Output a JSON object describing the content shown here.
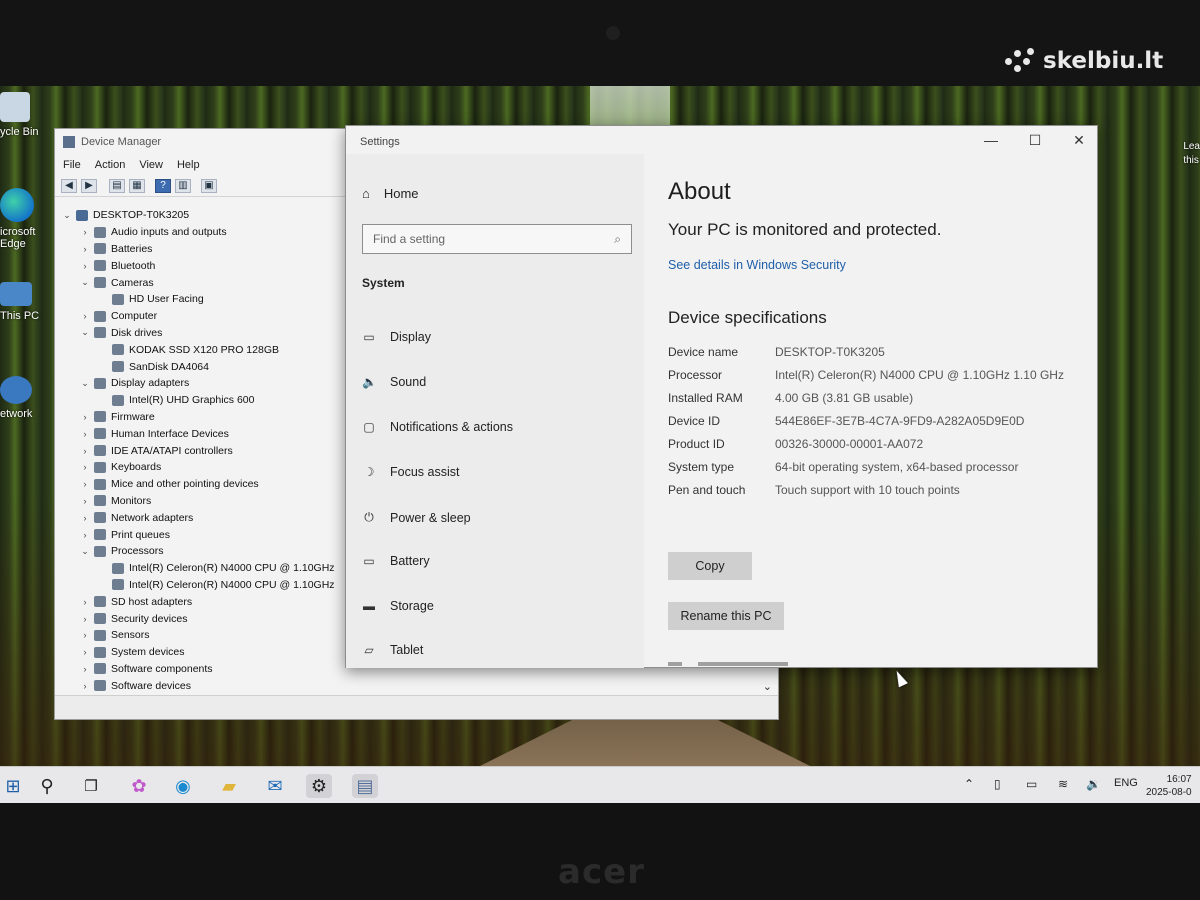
{
  "watermark": "skelbiu.lt",
  "laptop_brand": "acer",
  "desktop": {
    "icons": [
      {
        "label": "ycle Bin"
      },
      {
        "label": "icrosoft Edge"
      },
      {
        "label": "This PC"
      },
      {
        "label": "etwork"
      }
    ],
    "right_label_1": "Lea",
    "right_label_2": "this"
  },
  "device_manager": {
    "title": "Device Manager",
    "menu": [
      "File",
      "Action",
      "View",
      "Help"
    ],
    "root": "DESKTOP-T0K3205",
    "tree": [
      {
        "label": "Audio inputs and outputs",
        "level": 1,
        "expander": "collapsed",
        "icon": "audio-icon"
      },
      {
        "label": "Batteries",
        "level": 1,
        "expander": "collapsed",
        "icon": "battery-icon"
      },
      {
        "label": "Bluetooth",
        "level": 1,
        "expander": "collapsed",
        "icon": "bluetooth-icon"
      },
      {
        "label": "Cameras",
        "level": 1,
        "expander": "expanded",
        "icon": "camera-icon"
      },
      {
        "label": "HD User Facing",
        "level": 2,
        "expander": "none",
        "icon": "camera-icon"
      },
      {
        "label": "Computer",
        "level": 1,
        "expander": "collapsed",
        "icon": "computer-icon"
      },
      {
        "label": "Disk drives",
        "level": 1,
        "expander": "expanded",
        "icon": "disk-icon"
      },
      {
        "label": "KODAK SSD X120 PRO 128GB",
        "level": 2,
        "expander": "none",
        "icon": "disk-icon"
      },
      {
        "label": "SanDisk DA4064",
        "level": 2,
        "expander": "none",
        "icon": "disk-icon"
      },
      {
        "label": "Display adapters",
        "level": 1,
        "expander": "expanded",
        "icon": "monitor-icon"
      },
      {
        "label": "Intel(R) UHD Graphics 600",
        "level": 2,
        "expander": "none",
        "icon": "monitor-icon"
      },
      {
        "label": "Firmware",
        "level": 1,
        "expander": "collapsed",
        "icon": "firmware-icon"
      },
      {
        "label": "Human Interface Devices",
        "level": 1,
        "expander": "collapsed",
        "icon": "hid-icon"
      },
      {
        "label": "IDE ATA/ATAPI controllers",
        "level": 1,
        "expander": "collapsed",
        "icon": "controller-icon"
      },
      {
        "label": "Keyboards",
        "level": 1,
        "expander": "collapsed",
        "icon": "keyboard-icon"
      },
      {
        "label": "Mice and other pointing devices",
        "level": 1,
        "expander": "collapsed",
        "icon": "mouse-icon"
      },
      {
        "label": "Monitors",
        "level": 1,
        "expander": "collapsed",
        "icon": "monitor-icon"
      },
      {
        "label": "Network adapters",
        "level": 1,
        "expander": "collapsed",
        "icon": "network-icon"
      },
      {
        "label": "Print queues",
        "level": 1,
        "expander": "collapsed",
        "icon": "printer-icon"
      },
      {
        "label": "Processors",
        "level": 1,
        "expander": "expanded",
        "icon": "processor-icon"
      },
      {
        "label": "Intel(R) Celeron(R) N4000 CPU @ 1.10GHz",
        "level": 2,
        "expander": "none",
        "icon": "processor-icon"
      },
      {
        "label": "Intel(R) Celeron(R) N4000 CPU @ 1.10GHz",
        "level": 2,
        "expander": "none",
        "icon": "processor-icon"
      },
      {
        "label": "SD host adapters",
        "level": 1,
        "expander": "collapsed",
        "icon": "sd-icon"
      },
      {
        "label": "Security devices",
        "level": 1,
        "expander": "collapsed",
        "icon": "security-icon"
      },
      {
        "label": "Sensors",
        "level": 1,
        "expander": "collapsed",
        "icon": "sensor-icon"
      },
      {
        "label": "System devices",
        "level": 1,
        "expander": "collapsed",
        "icon": "system-icon"
      },
      {
        "label": "Software components",
        "level": 1,
        "expander": "collapsed",
        "icon": "software-icon"
      },
      {
        "label": "Software devices",
        "level": 1,
        "expander": "collapsed",
        "icon": "software-icon"
      }
    ]
  },
  "settings": {
    "window_title": "Settings",
    "home": "Home",
    "search_placeholder": "Find a setting",
    "section": "System",
    "nav": [
      {
        "label": "Display",
        "icon": "display-icon"
      },
      {
        "label": "Sound",
        "icon": "sound-icon"
      },
      {
        "label": "Notifications & actions",
        "icon": "notifications-icon"
      },
      {
        "label": "Focus assist",
        "icon": "focus-assist-icon"
      },
      {
        "label": "Power & sleep",
        "icon": "power-icon"
      },
      {
        "label": "Battery",
        "icon": "battery-icon"
      },
      {
        "label": "Storage",
        "icon": "storage-icon"
      },
      {
        "label": "Tablet",
        "icon": "tablet-icon"
      }
    ],
    "about": {
      "heading": "About",
      "protection": "Your PC is monitored and protected.",
      "security_link": "See details in Windows Security",
      "specs_heading": "Device specifications",
      "specs": [
        {
          "key": "Device name",
          "value": "DESKTOP-T0K3205"
        },
        {
          "key": "Processor",
          "value": "Intel(R) Celeron(R) N4000 CPU @ 1.10GHz   1.10 GHz"
        },
        {
          "key": "Installed RAM",
          "value": "4.00 GB (3.81 GB usable)"
        },
        {
          "key": "Device ID",
          "value": "544E86EF-3E7B-4C7A-9FD9-A282A05D9E0D"
        },
        {
          "key": "Product ID",
          "value": "00326-30000-00001-AA072"
        },
        {
          "key": "System type",
          "value": "64-bit operating system, x64-based processor"
        },
        {
          "key": "Pen and touch",
          "value": "Touch support with 10 touch points"
        }
      ],
      "copy_button": "Copy",
      "rename_button": "Rename this PC"
    }
  },
  "taskbar": {
    "language": "ENG",
    "time": "16:07",
    "date": "2025-08-0"
  }
}
